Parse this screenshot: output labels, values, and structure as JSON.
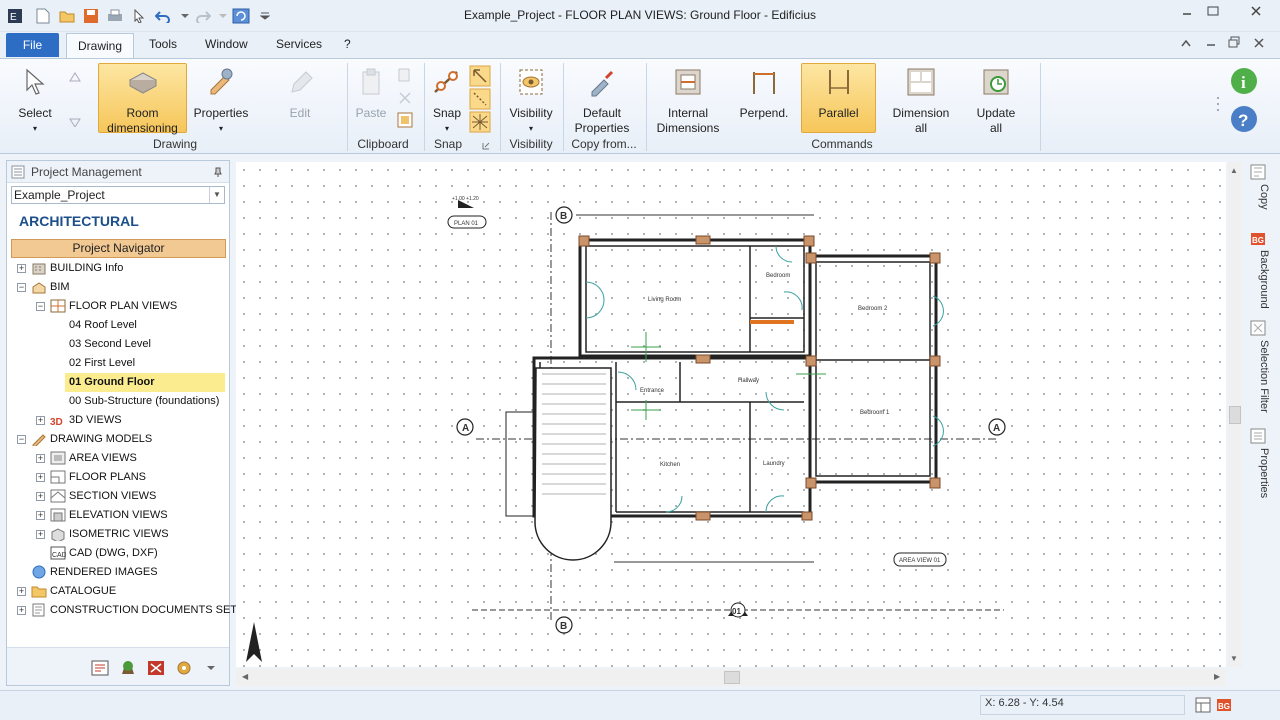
{
  "window": {
    "title": "Example_Project -  FLOOR PLAN VIEWS: Ground Floor - Edificius"
  },
  "menu": {
    "file": "File",
    "tabs": [
      "Drawing",
      "Tools",
      "Window",
      "Services",
      "?"
    ]
  },
  "ribbon": {
    "select": "Select",
    "room_dimensioning_1": "Room",
    "room_dimensioning_2": "dimensioning",
    "properties": "Properties",
    "edit": "Edit",
    "paste": "Paste",
    "snap": "Snap",
    "visibility": "Visibility",
    "default_properties_1": "Default",
    "default_properties_2": "Properties",
    "internal_dimensions_1": "Internal",
    "internal_dimensions_2": "Dimensions",
    "perpend": "Perpend.",
    "parallel": "Parallel",
    "dimension_all_1": "Dimension",
    "dimension_all_2": "all",
    "update_all_1": "Update",
    "update_all_2": "all",
    "groups": {
      "drawing": "Drawing",
      "clipboard": "Clipboard",
      "snap": "Snap",
      "visibility": "Visibility",
      "copy_from": "Copy from...",
      "commands": "Commands"
    }
  },
  "left_panel": {
    "title": "Project Management",
    "project": "Example_Project",
    "heading": "ARCHITECTURAL",
    "navigator_button": "Project Navigator",
    "tree": {
      "building_info": "BUILDING Info",
      "bim": "BIM",
      "floor_plan_views": "FLOOR PLAN VIEWS",
      "roof": "04 Roof Level",
      "second": "03 Second Level",
      "first": "02 First Level",
      "ground": "01 Ground Floor",
      "substructure": "00 Sub-Structure (foundations)",
      "views3d": "3D VIEWS",
      "drawing_models": "DRAWING MODELS",
      "area_views": "AREA VIEWS",
      "floor_plans": "FLOOR PLANS",
      "section_views": "SECTION VIEWS",
      "elevation_views": "ELEVATION VIEWS",
      "isometric_views": "ISOMETRIC VIEWS",
      "cad": "CAD (DWG, DXF)",
      "rendered_images": "RENDERED IMAGES",
      "catalogue": "CATALOGUE",
      "construction_docs": "CONSTRUCTION DOCUMENTS SET"
    }
  },
  "plan": {
    "level_label": "PLAN 01",
    "level_elev": "+1.00 +1.20",
    "rooms": {
      "living": "Living Room",
      "bedroom": "Bedroom",
      "bedroom2": "Bedroom 2",
      "bedroom1": "Bedroom 1",
      "entrance": "Entrance",
      "hallway": "Hallway",
      "kitchen": "Kitchen",
      "laundry": "Laundry"
    },
    "axis_a": "A",
    "axis_b": "B",
    "section_mark": "01",
    "area_view_label": "AREA VIEW 01"
  },
  "right_tabs": [
    "Copy",
    "Background",
    "Selection Filter",
    "Properties"
  ],
  "status": {
    "coords": "X: 6.28 - Y: 4.54"
  }
}
